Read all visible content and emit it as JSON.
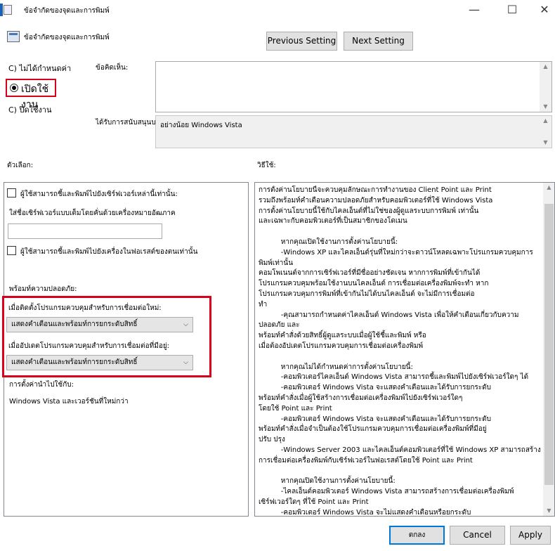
{
  "window": {
    "title": "ข้อจำกัดของจุดและการพิมพ์",
    "minimize": "—",
    "maximize": "☐",
    "close": "✕"
  },
  "header": {
    "policy_name": "ข้อจำกัดของจุดและการพิมพ์",
    "prev_button": "Previous Setting",
    "next_button": "Next Setting"
  },
  "state": {
    "not_configured": "C) ไม่ได้กำหนดค่า",
    "enabled": "เปิดใช้งาน",
    "disabled": "C) ปิดใช้งาน"
  },
  "comment": {
    "label": "ข้อคิดเห็น:",
    "value": ""
  },
  "supported": {
    "label": "ได้รับการสนับสนุนบน:",
    "value": "อย่างน้อย Windows Vista"
  },
  "options": {
    "heading": "ตัวเลือก:",
    "chk1": "ผู้ใช้สามารถชี้และพิมพ์ไปยังเซิร์ฟเวอร์เหล่านี้เท่านั้น:",
    "servers_label": "ใส่ชื่อเซิร์ฟเวอร์แบบเต็มโดยคั่นด้วยเครื่องหมายอัฒภาค",
    "servers_value": "",
    "chk2": "ผู้ใช้สามารถชี้และพิมพ์ไปยังเครื่องในฟอเรสต์ของตนเท่านั้น",
    "security_prompt": "พร้อมท์ความปลอดภัย:",
    "install_label": "เมื่อติดตั้งโปรแกรมควบคุมสำหรับการเชื่อมต่อใหม่:",
    "install_value": "แสดงคำเตือนและพร้อมท์การยกระดับสิทธิ์",
    "update_label": "เมื่ออัปเดตโปรแกรมควบคุมสำหรับการเชื่อมต่อที่มีอยู่:",
    "update_value": "แสดงคำเตือนและพร้อมท์การยกระดับสิทธิ์",
    "applies_label": "การตั้งค่านำไปใช้กับ:",
    "applies_value": "Windows Vista และเวอร์ชันที่ใหม่กว่า"
  },
  "help": {
    "heading": "วิธีใช้:",
    "text": "การตั้งค่านโยบายนี้จะควบคุมลักษณะการทำงานของ Client Point และ Print\nรวมถึงพร้อมท์คำเตือนความปลอดภัยสำหรับคอมพิวเตอร์ที่ใช้ Windows Vista\nการตั้งค่านโยบายนี้ใช้กับไคลเอ็นต์ที่ไม่ใช่ของผู้ดูแลระบบการพิมพ์ เท่านั้น\nและเฉพาะกับคอมพิวเตอร์ที่เป็นสมาชิกของโดเมน\n\n          หากคุณเปิดใช้งานการตั้งค่านโยบายนี้:\n          -Windows XP และไคลเอ็นต์รุ่นที่ใหม่กว่าจะดาวน์โหลดเฉพาะโปรแกรมควบคุมการพิมพ์เท่านั้น\nคอมโพเนนต์จากการเซิร์ฟเวอร์ที่มีชื่ออย่างชัดเจน หากการพิมพ์ที่เข้ากันได้\nโปรแกรมควบคุมพร้อมใช้งานบนไคลเอ็นต์ การเชื่อมต่อเครื่องพิมพ์จะทำ หาก\nโปรแกรมควบคุมการพิมพ์ที่เข้ากันไม่ได้บนไคลเอ็นต์ จะไม่มีการเชื่อมต่อ\nทำ\n          -คุณสามารถกำหนดค่าไคลเอ็นต์ Windows Vista เพื่อให้คำเตือนเกี่ยวกับความปลอดภัย และ\nพร้อมท์คำสั่งด้วยสิทธิ์ผู้ดูแลระบบเมื่อผู้ใช้ชี้และพิมพ์ หรือ\nเมื่อต้องอัปเดตโปรแกรมควบคุมการเชื่อมต่อเครื่องพิมพ์\n\n          หากคุณไม่ได้กำหนดค่าการตั้งค่านโยบายนี้:\n          -คอมพิวเตอร์ไคลเอ็นต์ Windows Vista สามารถชี้และพิมพ์ไปยังเซิร์ฟเวอร์ใดๆ ได้\n          -คอมพิวเตอร์ Windows Vista จะแสดงคำเตือนและได้รับการยกระดับ\nพร้อมท์คำสั่งเมื่อผู้ใช้สร้างการเชื่อมต่อเครื่องพิมพ์ไปยังเซิร์ฟเวอร์ใดๆ\nโดยใช้ Point และ Print\n          -คอมพิวเตอร์ Windows Vista จะแสดงคำเตือนและได้รับการยกระดับ\nพร้อมท์คำสั่งเมื่อจำเป็นต้องใช้โปรแกรมควบคุมการเชื่อมต่อเครื่องพิมพ์ที่มีอยู่\nปรับ ปรุง\n          -Windows Server 2003 และไคลเอ็นต์คอมพิวเตอร์ที่ใช้ Windows XP สามารถสร้าง\nการเชื่อมต่อเครื่องพิมพ์กับเซิร์ฟเวอร์ในฟอเรสต์โดยใช้ Point และ Print\n\n          หากคุณปิดใช้งานการตั้งค่านโยบายนี้:\n          -ไคลเอ็นต์คอมพิวเตอร์ Windows Vista สามารถสร้างการเชื่อมต่อเครื่องพิมพ์\nเซิร์ฟเวอร์ใดๆ ที่ใช้ Point และ Print\n          -คอมพิวเตอร์ Windows Vista จะไม่แสดงคำเตือนหรือยกระดับ\nพร้อมท์คำสั่งเมื่อผู้ใช้สร้างการเชื่อมต่อเครื่องพิมพ์ไปยังเซิร์ฟเวอร์ใดๆ\nโดยใช้ Point และ Print"
  },
  "footer": {
    "ok": "ตกลง",
    "cancel": "Cancel",
    "apply": "Apply"
  }
}
